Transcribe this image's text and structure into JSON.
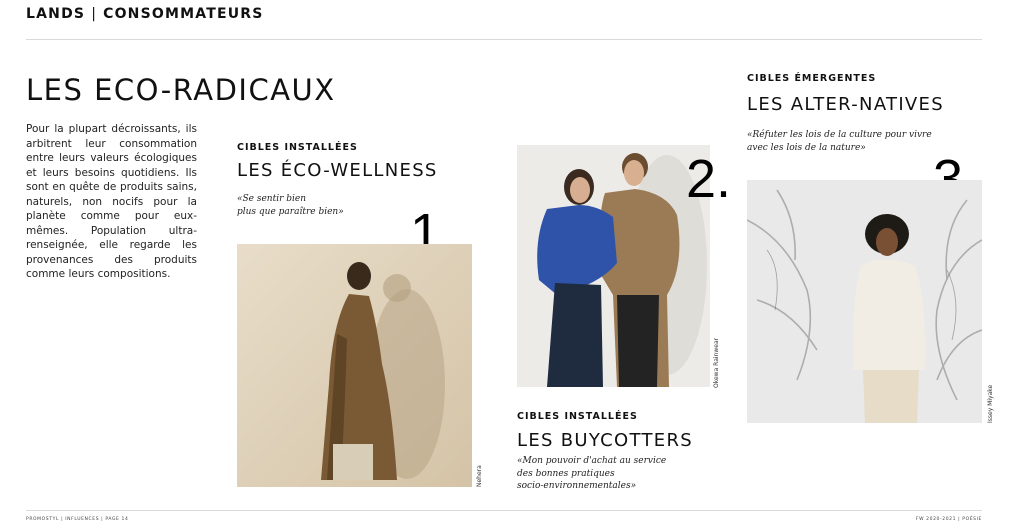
{
  "header": {
    "brand": "LANDS",
    "section": "CONSOMMATEURS"
  },
  "main": {
    "title": "LES ECO-RADICAUX",
    "intro": "Pour la plupart décroissants, ils arbitrent leur consommation entre leurs valeurs écologiques et leurs besoins quotidiens. Ils sont en quête de produits sains, naturels, non nocifs pour la planète comme pour eux-mêmes. Population ultra-renseignée, elle regarde les provenances des produits comme leurs compositions."
  },
  "targets": [
    {
      "kicker": "CIBLES INSTALLÉES",
      "title": "LES ÉCO-WELLNESS",
      "quote_lines": [
        "«Se sentir bien",
        "plus que paraître bien»"
      ],
      "number": "1.",
      "credit": "Nehera"
    },
    {
      "kicker": "CIBLES INSTALLÉES",
      "title": "LES BUYCOTTERS",
      "quote_lines": [
        "«Mon pouvoir d'achat au service",
        "des bonnes pratiques",
        "socio-environnementales»"
      ],
      "number": "2.",
      "credit": "Okewa Rainwear"
    },
    {
      "kicker": "CIBLES ÉMERGENTES",
      "title": "LES ALTER-NATIVES",
      "quote_lines": [
        "«Réfuter les lois de la culture pour vivre",
        "avec les lois de la nature»"
      ],
      "number": "3.",
      "credit": "Issey Miyake"
    }
  ],
  "footer": {
    "left": "PROMOSTYL  |  INFLUENCES  |  PAGE 14",
    "right": "FW 2020-2021  |  POÉSIE"
  }
}
